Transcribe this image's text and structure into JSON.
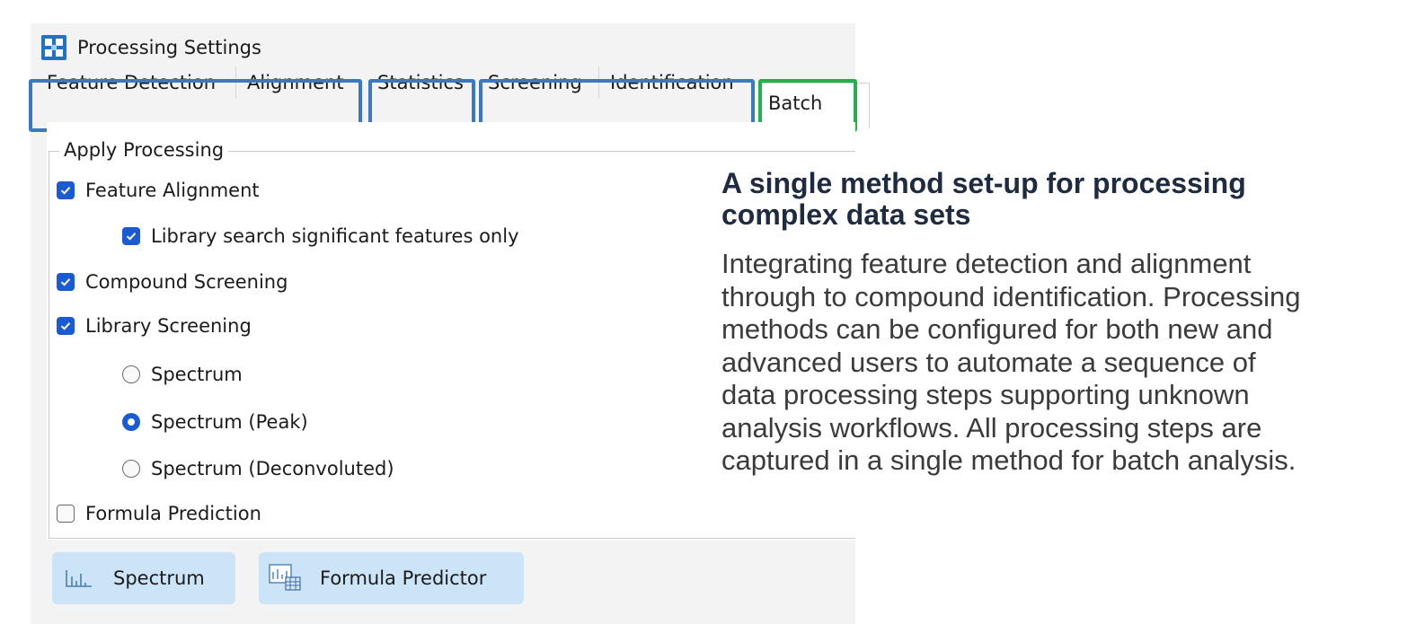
{
  "window": {
    "title": "Processing Settings",
    "icon": "processing-app-icon"
  },
  "tabs": [
    {
      "label": "Feature Detection"
    },
    {
      "label": "Alignment"
    },
    {
      "label": "Statistics"
    },
    {
      "label": "Screening"
    },
    {
      "label": "Identification"
    },
    {
      "label": "Batch",
      "selected": true
    }
  ],
  "highlight_colors": {
    "blue": "#3a78c2",
    "green": "#22b04b"
  },
  "group": {
    "legend": "Apply Processing",
    "options": {
      "feature_alignment": {
        "label": "Feature Alignment",
        "checked": true
      },
      "library_search_significant": {
        "label": "Library search significant features only",
        "checked": true
      },
      "compound_screening": {
        "label": "Compound Screening",
        "checked": true
      },
      "library_screening": {
        "label": "Library Screening",
        "checked": true
      },
      "spectrum": {
        "label": "Spectrum",
        "selected": false
      },
      "spectrum_peak": {
        "label": "Spectrum (Peak)",
        "selected": true
      },
      "spectrum_deconvoluted": {
        "label": "Spectrum (Deconvoluted)",
        "selected": false
      },
      "formula_prediction": {
        "label": "Formula Prediction",
        "checked": false
      }
    }
  },
  "buttons": {
    "spectrum": {
      "label": "Spectrum",
      "icon": "spectrum-chart-icon"
    },
    "formula_predictor": {
      "label": "Formula Predictor",
      "icon": "formula-predictor-icon"
    }
  },
  "accent_color": "#1a5bd4",
  "description": {
    "headline": [
      "A single method set-up for processing",
      "complex data sets"
    ],
    "lines": [
      "Integrating feature detection and alignment",
      "through to compound identification. Processing",
      "methods can be configured for both new and",
      "advanced users to automate a sequence of",
      "data processing steps supporting unknown",
      "analysis workflows. All processing steps are",
      "captured in a single method for batch analysis."
    ]
  }
}
